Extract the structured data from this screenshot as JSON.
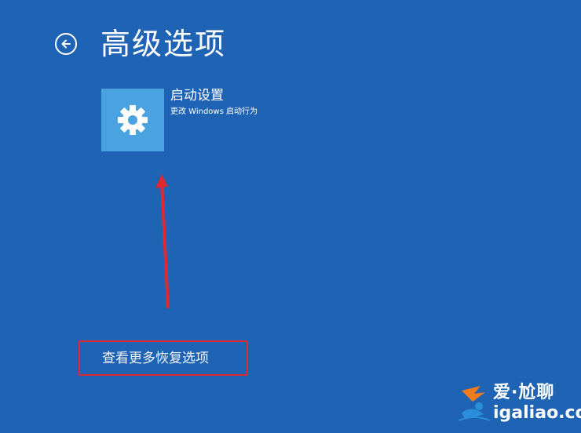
{
  "header": {
    "title": "高级选项",
    "back_icon": "back-arrow-icon"
  },
  "tiles": [
    {
      "title": "启动设置",
      "description": "更改 Windows 启动行为",
      "icon": "gear-icon",
      "tile_color": "#4aa3e0"
    }
  ],
  "footer": {
    "more_options_label": "查看更多恢复选项"
  },
  "annotations": {
    "highlight_color": "#e02830",
    "arrow_color": "#e02830"
  },
  "watermark": {
    "brand": "爱·尬聊",
    "domain": "igaliao.com"
  },
  "colors": {
    "background": "#1f64b4"
  }
}
